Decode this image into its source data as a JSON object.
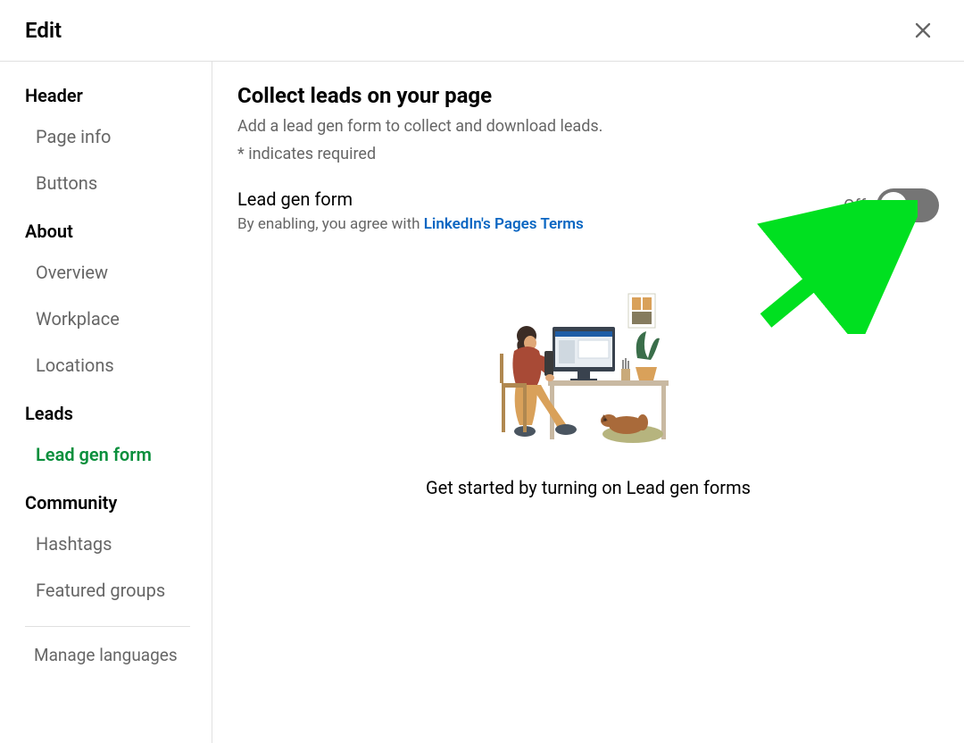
{
  "modal": {
    "title": "Edit"
  },
  "sidebar": {
    "sections": [
      {
        "title": "Header",
        "items": [
          {
            "label": "Page info",
            "active": false
          },
          {
            "label": "Buttons",
            "active": false
          }
        ]
      },
      {
        "title": "About",
        "items": [
          {
            "label": "Overview",
            "active": false
          },
          {
            "label": "Workplace",
            "active": false
          },
          {
            "label": "Locations",
            "active": false
          }
        ]
      },
      {
        "title": "Leads",
        "items": [
          {
            "label": "Lead gen form",
            "active": true
          }
        ]
      },
      {
        "title": "Community",
        "items": [
          {
            "label": "Hashtags",
            "active": false
          },
          {
            "label": "Featured groups",
            "active": false
          }
        ]
      }
    ],
    "footer": {
      "label": "Manage languages"
    }
  },
  "content": {
    "title": "Collect leads on your page",
    "subtitle": "Add a lead gen form to collect and download leads.",
    "required_note": "*  indicates required",
    "toggle": {
      "title": "Lead gen form",
      "subtitle_prefix": "By enabling, you agree with ",
      "terms_link_text": "LinkedIn's Pages Terms",
      "state_label": "Off"
    },
    "placeholder_text": "Get started by turning on Lead gen forms"
  }
}
